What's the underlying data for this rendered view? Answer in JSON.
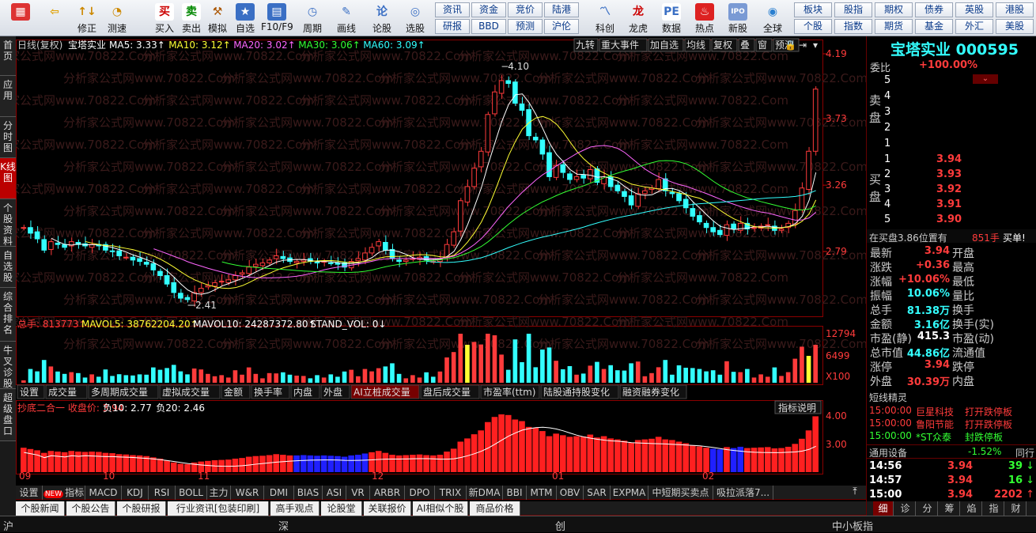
{
  "toolbar": {
    "buttons": [
      {
        "label": "",
        "icon": "logo-icon"
      },
      {
        "label": "",
        "icon": "back-arrow-icon"
      },
      {
        "label": "修正",
        "icon": "fix-icon"
      },
      {
        "label": "测速",
        "icon": "speed-icon"
      },
      {
        "label": "买入",
        "icon": "buy-icon"
      },
      {
        "label": "卖出",
        "icon": "sell-icon"
      },
      {
        "label": "模拟",
        "icon": "hammer-icon"
      },
      {
        "label": "自选",
        "icon": "star-icon"
      },
      {
        "label": "F10/F9",
        "icon": "f10-icon"
      },
      {
        "label": "周期",
        "icon": "clock-icon"
      },
      {
        "label": "画线",
        "icon": "pencil-icon"
      },
      {
        "label": "论股",
        "icon": "discuss-icon"
      },
      {
        "label": "选股",
        "icon": "pick-icon"
      },
      {
        "label": "科创",
        "icon": "kc-icon"
      },
      {
        "label": "龙虎",
        "icon": "dragon-icon"
      },
      {
        "label": "数据",
        "icon": "pe-icon"
      },
      {
        "label": "热点",
        "icon": "hot-icon"
      },
      {
        "label": "新股",
        "icon": "ipo-icon"
      },
      {
        "label": "全球",
        "icon": "globe-icon"
      }
    ],
    "links": [
      "资讯",
      "资金",
      "竞价",
      "陆港",
      "研报",
      "BBD",
      "预测",
      "沪伦"
    ],
    "links2": [
      "板块",
      "股指",
      "期权",
      "债券",
      "英股",
      "港股",
      "个股",
      "指数",
      "期货",
      "基金",
      "外汇",
      "美股"
    ]
  },
  "sidebar": [
    "首页",
    "应用",
    "分时图",
    "K线图",
    "个股资料",
    "自选股",
    "综合排名",
    "牛叉诊股",
    "超级盘口"
  ],
  "chart": {
    "header_label": "日线(复权)",
    "stock_name": "宝塔实业",
    "ma": [
      {
        "t": "MA5: 3.33",
        "c": "#fff"
      },
      {
        "t": "MA10: 3.12",
        "c": "#ffff33"
      },
      {
        "t": "MA20: 3.02",
        "c": "#ff66ff"
      },
      {
        "t": "MA30: 3.06",
        "c": "#33ff33"
      },
      {
        "t": "MA60: 3.09",
        "c": "#33ffff"
      }
    ],
    "tools": [
      "九转",
      "重大事件",
      "加自选",
      "均线",
      "复权",
      "叠",
      "窗",
      "预测"
    ],
    "price_ticks": [
      "4.19",
      "3.73",
      "3.26",
      "2.79"
    ],
    "high_label": "4.10",
    "low_label": "2.41",
    "vol_header": [
      {
        "t": "总手: 813773",
        "c": "#ff3b3b"
      },
      {
        "t": "MAVOL5: 38762204.20",
        "c": "#ffff33"
      },
      {
        "t": "MAVOL10: 24287372.80",
        "c": "#fff"
      },
      {
        "t": "STAND_VOL: 0",
        "c": "#fff"
      }
    ],
    "vol_ticks": [
      "12794",
      "6499",
      "X100"
    ],
    "ind_tabs": [
      "设置",
      "成交量",
      "多周期成交量",
      "虚拟成交量",
      "金额",
      "换手率",
      "内盘",
      "外盘",
      "AI立桩成交量",
      "盘后成交量",
      "市盈率(ttm)",
      "陆股通持股变化",
      "融资融券变化"
    ],
    "ind_header": [
      {
        "t": "抄底二合一 收盘价: 3.94",
        "c": "#ff3b3b"
      },
      {
        "t": "负10: 2.77",
        "c": "#fff"
      },
      {
        "t": "负20: 2.46",
        "c": "#fff"
      }
    ],
    "ind_help": "指标说明",
    "ind_ticks": [
      "4.00",
      "3.00"
    ],
    "months": [
      "09",
      "10",
      "11",
      "12",
      "01",
      "02"
    ],
    "bottom_tabs": [
      "设置",
      "指标平台",
      "MACD",
      "KDJ",
      "RSI",
      "BOLL",
      "主力",
      "W&R",
      "DMI",
      "BIAS",
      "ASI",
      "VR",
      "ARBR",
      "DPO",
      "TRIX",
      "新DMA",
      "BBI",
      "MTM",
      "OBV",
      "SAR",
      "EXPMA",
      "中短期买卖点",
      "吸拉派落7..."
    ],
    "new_badge": "NEW",
    "news_tabs": [
      "个股新闻",
      "个股公告",
      "个股研报",
      "行业资讯[包装印刷]",
      "高手观点",
      "论股堂",
      "关联报价",
      "AI相似个股",
      "商品价格"
    ],
    "watermark": "分析家公式网www.70822.Com"
  },
  "chart_data": {
    "type": "candlestick",
    "price_range": [
      2.41,
      4.19
    ],
    "close": [
      2.96,
      2.92,
      2.88,
      2.8,
      2.86,
      2.84,
      2.82,
      2.86,
      2.84,
      2.83,
      2.84,
      2.83,
      2.8,
      2.79,
      2.76,
      2.75,
      2.73,
      2.72,
      2.7,
      2.66,
      2.62,
      2.56,
      2.5,
      2.46,
      2.45,
      2.5,
      2.53,
      2.55,
      2.57,
      2.58,
      2.59,
      2.62,
      2.64,
      2.68,
      2.7,
      2.71,
      2.73,
      2.76,
      2.74,
      2.72,
      2.72,
      2.73,
      2.72,
      2.71,
      2.72,
      2.71,
      2.7,
      2.68,
      2.72,
      2.74,
      2.78,
      2.82,
      2.86,
      2.8,
      2.74,
      2.72,
      2.73,
      2.74,
      2.75,
      2.73,
      2.72,
      2.74,
      2.84,
      2.93,
      3.15,
      3.25,
      3.38,
      3.5,
      3.76,
      3.92,
      4.0,
      3.98,
      3.84,
      3.79,
      3.61,
      3.58,
      3.48,
      3.32,
      3.4,
      3.35,
      3.3,
      3.32,
      3.31,
      3.37,
      3.28,
      3.32,
      3.25,
      3.22,
      3.18,
      3.12,
      3.2,
      3.22,
      3.24,
      3.3,
      3.22,
      3.2,
      3.15,
      3.1,
      3.04,
      3.0,
      2.96,
      2.93,
      2.91,
      2.98,
      2.95,
      2.99,
      2.95,
      2.96,
      2.97,
      2.98,
      2.94,
      2.95,
      2.99,
      3.08,
      3.24,
      3.5,
      3.94
    ],
    "volume_scale": [
      0,
      12794
    ],
    "indicator_range": [
      2.46,
      4.0
    ],
    "last": {
      "close": 3.94,
      "ma5": 3.33,
      "ma10": 3.12,
      "ma20": 3.02,
      "ma30": 3.06,
      "ma60": 3.09
    }
  },
  "quote": {
    "title": "宝塔实业 000595",
    "weibi_label": "委比",
    "weibi": "+100.00%",
    "sell_label": "卖盘",
    "buy_label": "买盘",
    "asks": [
      {
        "n": "5",
        "p": ""
      },
      {
        "n": "4",
        "p": ""
      },
      {
        "n": "3",
        "p": ""
      },
      {
        "n": "2",
        "p": ""
      },
      {
        "n": "1",
        "p": ""
      }
    ],
    "bids": [
      {
        "n": "1",
        "p": "3.94"
      },
      {
        "n": "2",
        "p": "3.93"
      },
      {
        "n": "3",
        "p": "3.92"
      },
      {
        "n": "4",
        "p": "3.91"
      },
      {
        "n": "5",
        "p": "3.90"
      }
    ],
    "queue": "在买盘3.86位置有",
    "queue_vol": "851手",
    "queue_buy": "买单!",
    "stats": [
      {
        "l": "最新",
        "v": "3.94",
        "c": "#ff3b3b",
        "l2": "开盘"
      },
      {
        "l": "涨跌",
        "v": "+0.36",
        "c": "#ff3b3b",
        "l2": "最高"
      },
      {
        "l": "涨幅",
        "v": "+10.06%",
        "c": "#ff3b3b",
        "l2": "最低"
      },
      {
        "l": "振幅",
        "v": "10.06%",
        "c": "#33ffff",
        "l2": "量比"
      },
      {
        "l": "总手",
        "v": "81.38万",
        "c": "#33ffff",
        "l2": "换手"
      },
      {
        "l": "金额",
        "v": "3.16亿",
        "c": "#33ffff",
        "l2": "换手(实)"
      },
      {
        "l": "市盈(静)",
        "v": "415.3",
        "c": "#fff",
        "l2": "市盈(动)"
      },
      {
        "l": "总市值",
        "v": "44.86亿",
        "c": "#33ffff",
        "l2": "流通值"
      },
      {
        "l": "涨停",
        "v": "3.94",
        "c": "#ff3b3b",
        "l2": "跌停"
      },
      {
        "l": "外盘",
        "v": "30.39万",
        "c": "#ff3b3b",
        "l2": "内盘"
      }
    ],
    "flash_title": "短线精灵",
    "flash": [
      {
        "t": "15:00:00",
        "n": "巨星科技",
        "e": "打开跌停板",
        "c": "#ff3b3b"
      },
      {
        "t": "15:00:00",
        "n": "鲁阳节能",
        "e": "打开跌停板",
        "c": "#ff3b3b"
      },
      {
        "t": "15:00:00",
        "n": "*ST众泰",
        "e": "封跌停板",
        "c": "#33ff33"
      }
    ],
    "sector": "通用设备",
    "sector_chg": "-1.52%",
    "sector_more": "同行",
    "ticks": [
      {
        "t": "14:56",
        "p": "3.94",
        "v": "39",
        "c": "#33ff33"
      },
      {
        "t": "14:57",
        "p": "3.94",
        "v": "16",
        "c": "#33ff33"
      },
      {
        "t": "15:00",
        "p": "3.94",
        "v": "2202",
        "c": "#ff3b3b"
      }
    ],
    "tabs": [
      "细",
      "诊",
      "分",
      "筹",
      "焰",
      "指",
      "财"
    ]
  },
  "status": {
    "items": [
      "沪",
      "深",
      "创",
      "中小板指"
    ]
  }
}
